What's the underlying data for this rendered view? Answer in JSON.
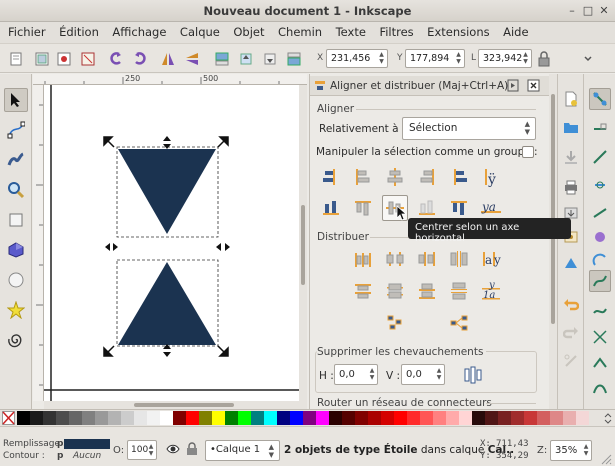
{
  "window": {
    "title": "Nouveau document 1 - Inkscape"
  },
  "menu": [
    "Fichier",
    "Édition",
    "Affichage",
    "Calque",
    "Objet",
    "Chemin",
    "Texte",
    "Filtres",
    "Extensions",
    "Aide"
  ],
  "coords": {
    "x_label": "X",
    "x_value": "231,456",
    "y_label": "Y",
    "y_value": "177,894",
    "w_label": "L",
    "w_value": "323,942"
  },
  "ruler": {
    "labels": [
      "250",
      "500"
    ]
  },
  "dock": {
    "title": "Aligner et distribuer (Maj+Ctrl+A)",
    "align_section": "Aligner",
    "relative_label": "Relativement à :",
    "relative_value": "Sélection",
    "group_label": "Manipuler la sélection comme un groupe :",
    "distribute_section": "Distribuer",
    "overlap_section": "Supprimer les chevauchements",
    "h_label": "H :",
    "h_value": "0,0",
    "v_label": "V :",
    "v_value": "0,0",
    "connectors_section": "Router un réseau de connecteurs"
  },
  "tooltip": "Centrer selon un axe horizontal",
  "colors": {
    "shape_fill": "#1b3350",
    "accent": "#e8a13a",
    "palette": [
      "#000000",
      "#1a1a1a",
      "#333333",
      "#4d4d4d",
      "#666666",
      "#808080",
      "#999999",
      "#b3b3b3",
      "#cccccc",
      "#e6e6e6",
      "#f2f2f2",
      "#ffffff",
      "#800000",
      "#ff0000",
      "#808000",
      "#ffff00",
      "#008000",
      "#00ff00",
      "#008080",
      "#00ffff",
      "#000080",
      "#0000ff",
      "#800080",
      "#ff00ff",
      "#2b0000",
      "#550000",
      "#800000",
      "#aa0000",
      "#d40000",
      "#ff0000",
      "#ff2a2a",
      "#ff5555",
      "#ff8080",
      "#ffaaaa",
      "#ffd5d5",
      "#280b0b",
      "#501616",
      "#782121",
      "#a02c2c",
      "#c83737",
      "#d35f5f",
      "#de8787",
      "#e9afaf",
      "#f4d7d7"
    ]
  },
  "status": {
    "fill_label": "Remplissage :",
    "fill_flag": "p",
    "stroke_label": "Contour :",
    "stroke_flag": "p",
    "stroke_value": "Aucun",
    "opacity_label": "O:",
    "opacity_value": "100",
    "layer": "•Calque 1",
    "message_prefix": "2 objets de type ",
    "message_type": "Étoile",
    "message_mid": " dans calque ",
    "message_layer": "Cal..",
    "cursor_x_label": "X:",
    "cursor_x": "711,43",
    "cursor_y_label": "Y:",
    "cursor_y": "354,29",
    "zoom_label": "Z:",
    "zoom": "35%"
  }
}
